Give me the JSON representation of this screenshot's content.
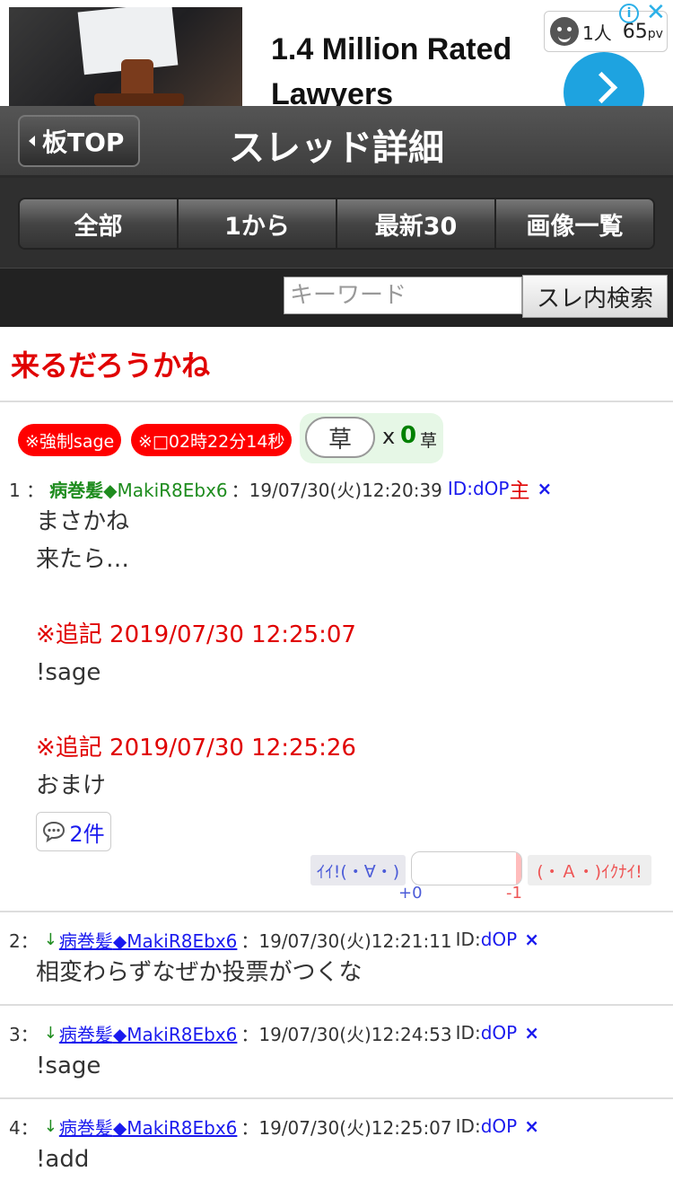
{
  "ad": {
    "headline": "1.4 Million Rated Lawyers",
    "viewers": "1人",
    "pageviews": "65",
    "pv_unit": "pv",
    "info_glyph": "i",
    "close_glyph": "✕"
  },
  "header": {
    "back_label": "板TOP",
    "title": "スレッド詳細"
  },
  "tabs": [
    {
      "label": "全部"
    },
    {
      "label": "1から"
    },
    {
      "label": "最新30"
    },
    {
      "label": "画像一覧"
    }
  ],
  "search": {
    "placeholder": "キーワード",
    "value": "",
    "button_label": "スレ内検索"
  },
  "thread": {
    "title": "来るだろうかね",
    "badges": [
      "※強制sage",
      "※□02時22分14秒"
    ],
    "kusa_button": "草",
    "kusa_multiplier": "x",
    "kusa_count": "0",
    "kusa_label": "草"
  },
  "posts": [
    {
      "num": "1",
      "sep": "：",
      "name": "病巻髪",
      "trip": "◆MakiR8Ebx6",
      "meta": "：19/07/30(火)12:20:39",
      "id_label": "ID:dOP",
      "owner_mark": "主",
      "delete_glyph": "×",
      "lines": [
        "まさかね",
        "来たら…"
      ],
      "addenda": [
        {
          "header": "※追記 2019/07/30 12:25:07",
          "text": "!sage"
        },
        {
          "header": "※追記 2019/07/30 12:25:26",
          "text": "おまけ"
        }
      ],
      "replies_label": "2件",
      "vote_good_label": "ｲｲ!(・∀・)",
      "vote_bad_label": "(・Ａ・)ｲｸﾅｲ!",
      "vote_plus": "+0",
      "vote_minus": "-1"
    },
    {
      "num": "2",
      "sep": "：",
      "arrow": "↓",
      "name": "病巻髪",
      "trip": "◆MakiR8Ebx6",
      "meta": "：19/07/30(火)12:21:11",
      "id_prefix": "ID:",
      "id_value": "dOP",
      "delete_glyph": "×",
      "text": "相変わらずなぜか投票がつくな"
    },
    {
      "num": "3",
      "sep": "：",
      "arrow": "↓",
      "name": "病巻髪",
      "trip": "◆MakiR8Ebx6",
      "meta": "：19/07/30(火)12:24:53",
      "id_prefix": "ID:",
      "id_value": "dOP",
      "delete_glyph": "×",
      "text": "!sage"
    },
    {
      "num": "4",
      "sep": "：",
      "arrow": "↓",
      "name": "病巻髪",
      "trip": "◆MakiR8Ebx6",
      "meta": "：19/07/30(火)12:25:07",
      "id_prefix": "ID:",
      "id_value": "dOP",
      "delete_glyph": "×",
      "text": "!add"
    }
  ],
  "colors": {
    "title_red": "#e00000",
    "name_green": "#1e8c1e",
    "link_blue": "#1a1aee",
    "badge_red": "#ff0000"
  },
  "icons": [
    "info-icon",
    "close-icon",
    "viewer-face-icon",
    "chevron-right-icon",
    "back-triangle-icon",
    "comment-bubble-icon"
  ]
}
